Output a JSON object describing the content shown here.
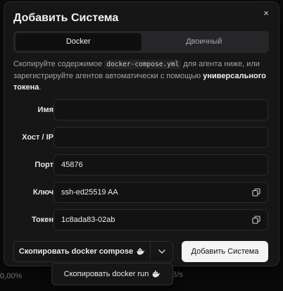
{
  "background": {
    "left_fragment": "0,00%",
    "right_fragment": "B/s"
  },
  "dialog": {
    "title": "Добавить Система",
    "close_glyph": "×",
    "tabs": [
      {
        "label": "Docker",
        "active": true
      },
      {
        "label": "Двоичный",
        "active": false
      }
    ],
    "description": {
      "part1": "Скопируйте содержимое ",
      "code": "docker-compose.yml",
      "part2": " для агента ниже, или зарегистрируйте агентов автоматически с помощью ",
      "bold": "универсального токена",
      "part3": "."
    },
    "fields": {
      "name": {
        "label": "Имя",
        "value": ""
      },
      "host": {
        "label": "Хост / IP",
        "value": ""
      },
      "port": {
        "label": "Порт",
        "value": "45876"
      },
      "key": {
        "label": "Ключ",
        "value": "ssh-ed25519 AA"
      },
      "token": {
        "label": "Токен",
        "value": "1c8ada83-02ab"
      }
    },
    "buttons": {
      "copy_compose": "Скопировать docker compose",
      "add_system": "Добавить Система"
    },
    "dropdown": {
      "copy_run": "Скопировать docker run"
    }
  },
  "colors": {
    "dialog_bg": "#161617",
    "border": "#2b2b2e",
    "primary_button": "#f4f4f5",
    "text": "#ececec"
  },
  "icons": [
    "close-icon",
    "copy-icon",
    "docker-whale-icon",
    "chevron-down-icon"
  ]
}
